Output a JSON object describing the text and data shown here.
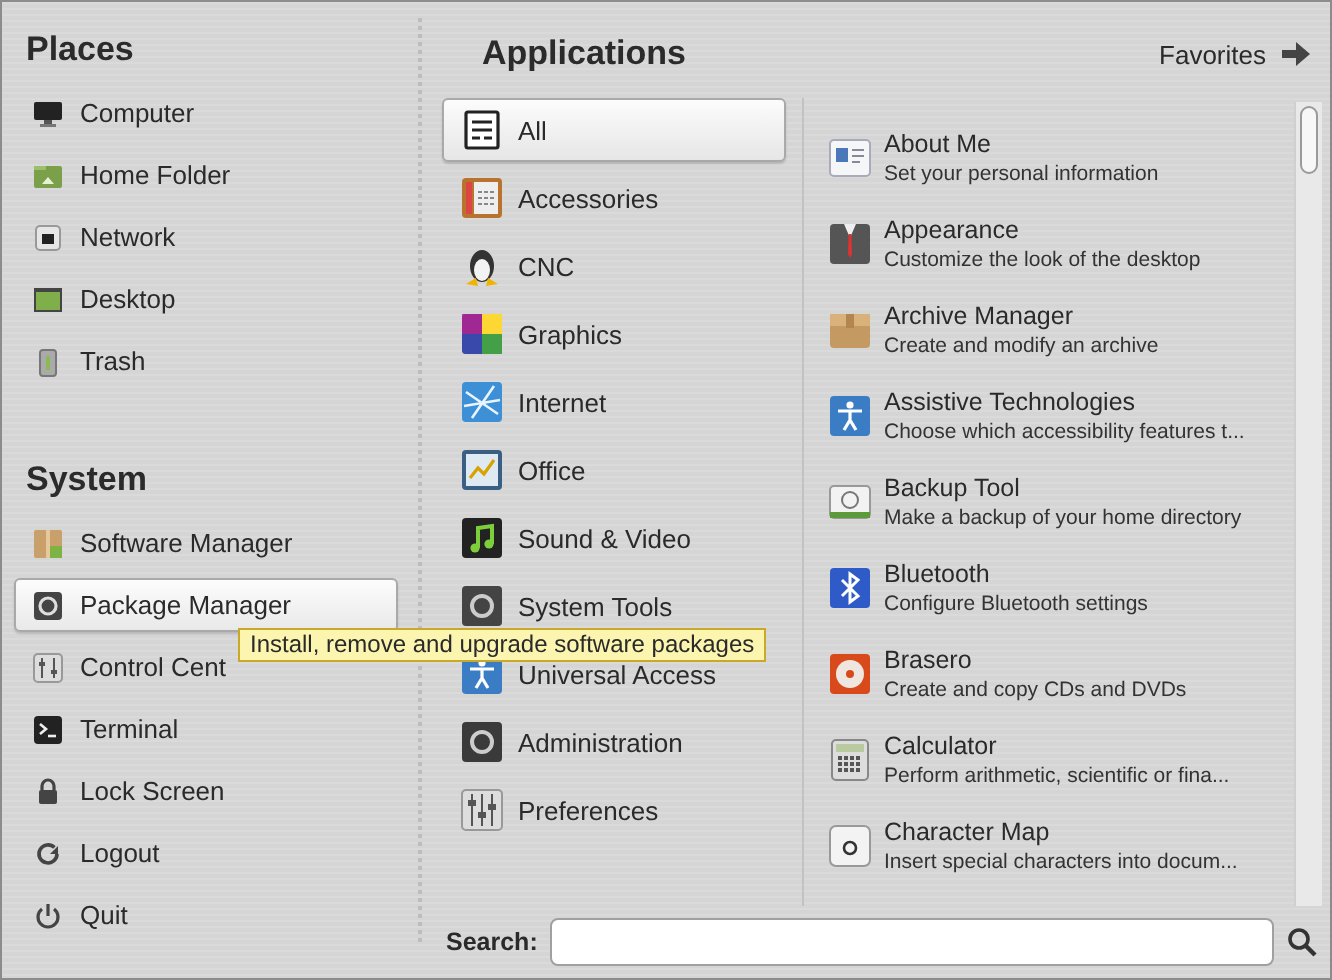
{
  "places": {
    "title": "Places",
    "items": [
      {
        "label": "Computer",
        "selected": false
      },
      {
        "label": "Home Folder",
        "selected": false
      },
      {
        "label": "Network",
        "selected": false
      },
      {
        "label": "Desktop",
        "selected": false
      },
      {
        "label": "Trash",
        "selected": false
      }
    ]
  },
  "system": {
    "title": "System",
    "items": [
      {
        "label": "Software Manager",
        "selected": false
      },
      {
        "label": "Package Manager",
        "selected": true
      },
      {
        "label": "Control Cent",
        "selected": false
      },
      {
        "label": "Terminal",
        "selected": false
      },
      {
        "label": "Lock Screen",
        "selected": false
      },
      {
        "label": "Logout",
        "selected": false
      },
      {
        "label": "Quit",
        "selected": false
      }
    ]
  },
  "tooltip": {
    "text": "Install, remove and upgrade software packages"
  },
  "applications": {
    "title": "Applications",
    "favorites_button": "Favorites"
  },
  "categories": [
    {
      "label": "All",
      "selected": true
    },
    {
      "label": "Accessories",
      "selected": false
    },
    {
      "label": "CNC",
      "selected": false
    },
    {
      "label": "Graphics",
      "selected": false
    },
    {
      "label": "Internet",
      "selected": false
    },
    {
      "label": "Office",
      "selected": false
    },
    {
      "label": "Sound & Video",
      "selected": false
    },
    {
      "label": "System Tools",
      "selected": false
    },
    {
      "label": "Universal Access",
      "selected": false
    },
    {
      "label": "Administration",
      "selected": false
    },
    {
      "label": "Preferences",
      "selected": false
    }
  ],
  "apps": [
    {
      "name": "About Me",
      "description": "Set your personal information"
    },
    {
      "name": "Appearance",
      "description": "Customize the look of the desktop"
    },
    {
      "name": "Archive Manager",
      "description": "Create and modify an archive"
    },
    {
      "name": "Assistive Technologies",
      "description": "Choose which accessibility features t..."
    },
    {
      "name": "Backup Tool",
      "description": "Make a backup of your home directory"
    },
    {
      "name": "Bluetooth",
      "description": "Configure Bluetooth settings"
    },
    {
      "name": "Brasero",
      "description": "Create and copy CDs and DVDs"
    },
    {
      "name": "Calculator",
      "description": "Perform arithmetic, scientific or fina..."
    },
    {
      "name": "Character Map",
      "description": "Insert special characters into docum..."
    }
  ],
  "search": {
    "label": "Search:"
  }
}
